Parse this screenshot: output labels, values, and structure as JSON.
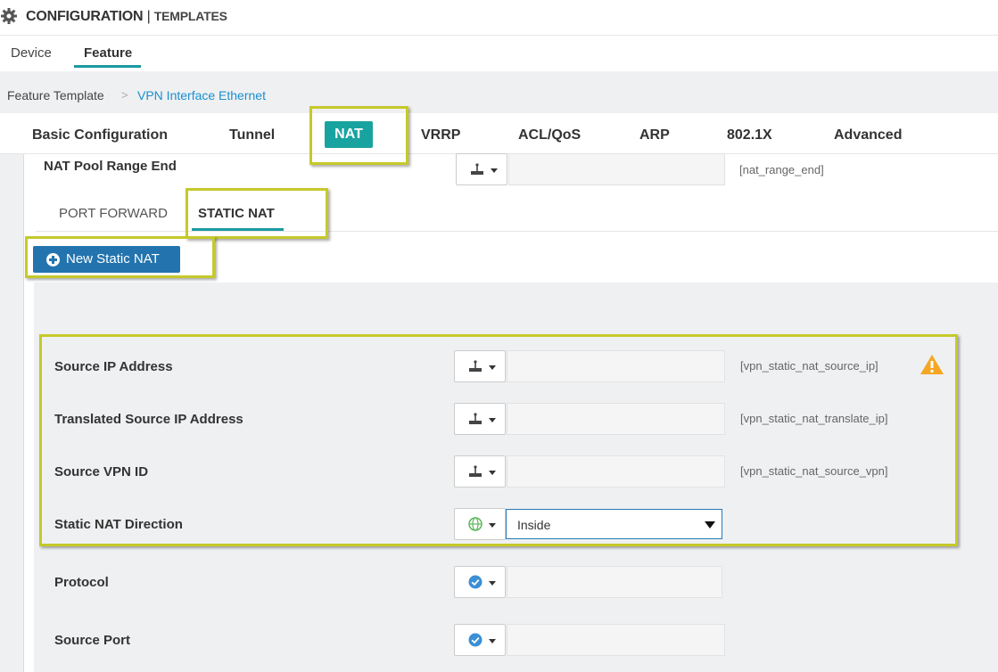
{
  "header": {
    "title": "CONFIGURATION",
    "separator": "|",
    "subtitle": "TEMPLATES",
    "icon": "gear-icon"
  },
  "top_tabs": [
    "Device",
    "Feature"
  ],
  "active_top_tab": "Feature",
  "breadcrumb": {
    "root": "Feature Template",
    "separator": ">",
    "current": "VPN Interface Ethernet"
  },
  "section_tabs": [
    "Basic Configuration",
    "Tunnel",
    "NAT",
    "VRRP",
    "ACL/QoS",
    "ARP",
    "802.1X",
    "Advanced"
  ],
  "active_section_tab": "NAT",
  "nat_pool_range_end": {
    "label": "NAT Pool Range End",
    "value": "",
    "hint": "[nat_range_end]",
    "scope_icon": "device-specific-icon"
  },
  "sub_tabs": [
    "PORT FORWARD",
    "STATIC NAT"
  ],
  "active_sub_tab": "STATIC NAT",
  "new_button_label": "New Static NAT",
  "static_nat_fields": [
    {
      "label": "Source IP Address",
      "value": "",
      "hint": "[vpn_static_nat_source_ip]",
      "scope_icon": "device-specific-icon"
    },
    {
      "label": "Translated Source IP Address",
      "value": "",
      "hint": "[vpn_static_nat_translate_ip]",
      "scope_icon": "device-specific-icon"
    },
    {
      "label": "Source VPN ID",
      "value": "",
      "hint": "[vpn_static_nat_source_vpn]",
      "scope_icon": "device-specific-icon"
    },
    {
      "label": "Static NAT Direction",
      "value": "Inside",
      "scope_icon": "globe-icon"
    },
    {
      "label": "Protocol",
      "value": "",
      "scope_icon": "check-icon"
    },
    {
      "label": "Source Port",
      "value": "",
      "scope_icon": "check-icon"
    }
  ],
  "colors": {
    "accent_teal": "#19a3a0",
    "button_blue": "#2374ae",
    "link_blue": "#1a8fce",
    "highlight_yellow": "#c6c92a",
    "warning_orange": "#f5a623"
  }
}
